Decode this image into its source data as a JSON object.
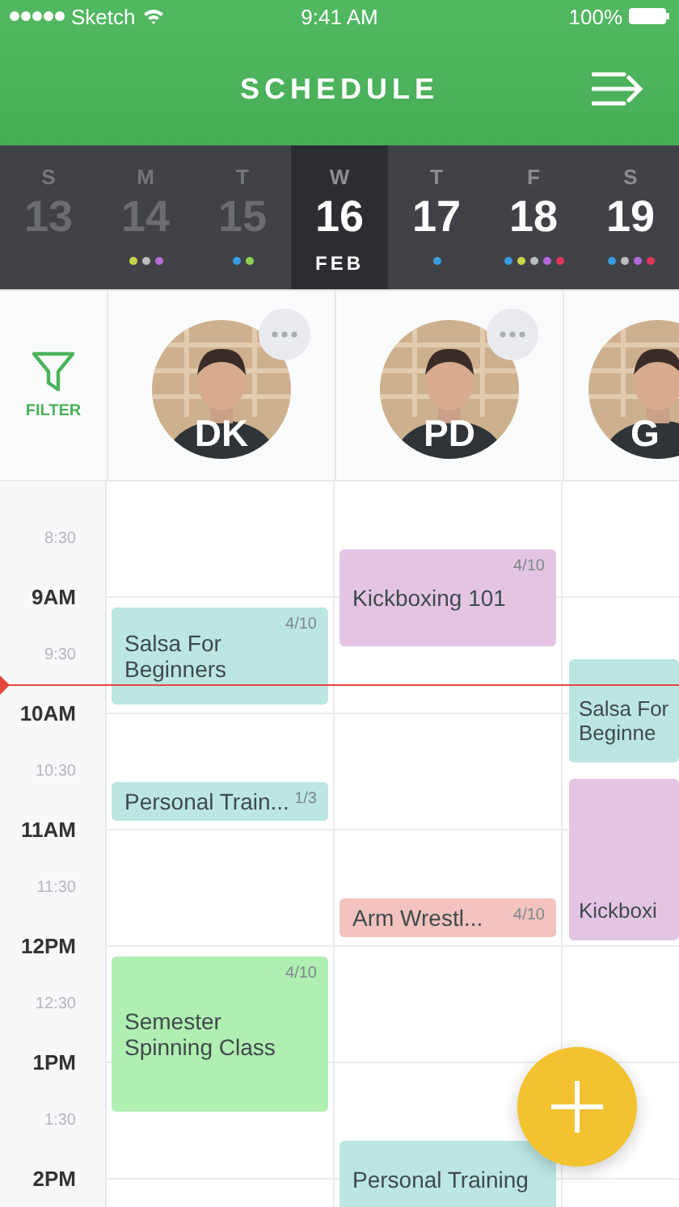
{
  "status_bar": {
    "carrier": "Sketch",
    "time": "9:41 AM",
    "battery": "100%"
  },
  "header": {
    "title": "SCHEDULE"
  },
  "days": [
    {
      "weekday": "S",
      "date": "13",
      "past": true,
      "selected": false
    },
    {
      "weekday": "M",
      "date": "14",
      "past": true,
      "selected": false,
      "dots": [
        {
          "color": "#c8d54c"
        },
        {
          "color": "#bcbcbc"
        },
        {
          "color": "#b46ad9"
        }
      ]
    },
    {
      "weekday": "T",
      "date": "15",
      "past": true,
      "selected": false,
      "dots": [
        {
          "color": "#3a9be0"
        },
        {
          "color": "#8fd14f"
        }
      ]
    },
    {
      "weekday": "W",
      "date": "16",
      "month": "FEB",
      "past": false,
      "selected": true
    },
    {
      "weekday": "T",
      "date": "17",
      "past": false,
      "selected": false,
      "dots": [
        {
          "color": "#3a9be0"
        }
      ]
    },
    {
      "weekday": "F",
      "date": "18",
      "past": false,
      "selected": false,
      "dots": [
        {
          "color": "#3a9be0"
        },
        {
          "color": "#c8d54c"
        },
        {
          "color": "#bcbcbc"
        },
        {
          "color": "#b46ad9"
        },
        {
          "color": "#e0355a"
        }
      ]
    },
    {
      "weekday": "S",
      "date": "19",
      "past": false,
      "selected": false,
      "dots": [
        {
          "color": "#3a9be0"
        },
        {
          "color": "#bcbcbc"
        },
        {
          "color": "#b46ad9"
        },
        {
          "color": "#e0355a"
        }
      ]
    }
  ],
  "filter": {
    "label": "FILTER"
  },
  "times": [
    {
      "label": "8:30",
      "kind": "half"
    },
    {
      "label": "9AM",
      "kind": "hour"
    },
    {
      "label": "9:30",
      "kind": "half"
    },
    {
      "label": "10AM",
      "kind": "hour"
    },
    {
      "label": "10:30",
      "kind": "half"
    },
    {
      "label": "11AM",
      "kind": "hour"
    },
    {
      "label": "11:30",
      "kind": "half"
    },
    {
      "label": "12PM",
      "kind": "hour"
    },
    {
      "label": "12:30",
      "kind": "half"
    },
    {
      "label": "1PM",
      "kind": "hour"
    },
    {
      "label": "1:30",
      "kind": "half"
    },
    {
      "label": "2PM",
      "kind": "hour"
    }
  ],
  "now_marker": true,
  "instructors": [
    {
      "initials": "DK",
      "has_menu": true,
      "events": [
        {
          "title": "Salsa For Beginners",
          "count": "4/10",
          "color": "#bce6e2"
        },
        {
          "title": "Personal Train...",
          "count": "1/3",
          "color": "#bce6e2"
        },
        {
          "title": "Semester Spinning Class",
          "count": "4/10",
          "color": "#b0eeb2"
        }
      ]
    },
    {
      "initials": "PD",
      "has_menu": true,
      "events": [
        {
          "title": "Kickboxing 101",
          "count": "4/10",
          "color": "#e3c5e3"
        },
        {
          "title": "Arm Wrestl...",
          "count": "4/10",
          "color": "#f2c3bf"
        },
        {
          "title": "Personal Training",
          "color": "#bce6e2"
        }
      ]
    },
    {
      "initials": "G",
      "events": [
        {
          "title": "Salsa For Beginne",
          "color": "#bce6e2"
        },
        {
          "title": "Kickboxi",
          "color": "#e3c5e3"
        }
      ]
    }
  ]
}
